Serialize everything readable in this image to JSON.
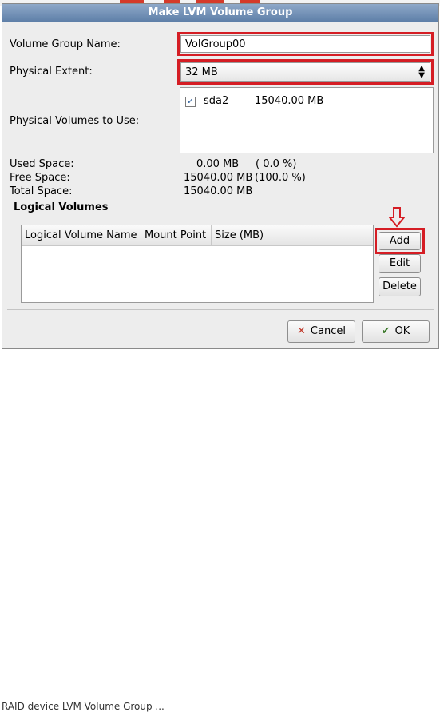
{
  "dialog": {
    "title": "Make LVM Volume Group"
  },
  "form": {
    "vg_name_label": "Volume Group Name:",
    "vg_name_value": "VolGroup00",
    "extent_label": "Physical Extent:",
    "extent_value": "32 MB",
    "pv_label": "Physical Volumes to Use:",
    "pv_items": [
      {
        "device": "sda2",
        "size": "15040.00 MB",
        "checked": true
      }
    ]
  },
  "space": {
    "used_label": "Used Space:",
    "used_value": "0.00 MB",
    "used_pct": "( 0.0 %)",
    "free_label": "Free Space:",
    "free_value": "15040.00 MB",
    "free_pct": "(100.0 %)",
    "total_label": "Total Space:",
    "total_value": "15040.00 MB"
  },
  "logical_volumes": {
    "heading": "Logical Volumes",
    "columns": [
      "Logical Volume Name",
      "Mount Point",
      "Size (MB)"
    ],
    "rows": []
  },
  "buttons": {
    "add": "Add",
    "edit": "Edit",
    "delete": "Delete",
    "cancel": "Cancel",
    "ok": "OK"
  },
  "background": {
    "bottom_text": "RAID device LVM Volume Group ..."
  },
  "colors": {
    "highlight": "#d51d24",
    "title_bar": "#6f8db5",
    "dialog_bg": "#ededed"
  }
}
